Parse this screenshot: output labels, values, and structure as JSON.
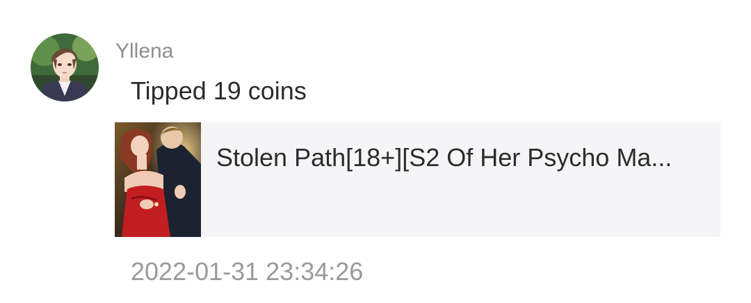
{
  "comment": {
    "username": "Yllena",
    "message": "Tipped 19 coins",
    "timestamp": "2022-01-31 23:34:26",
    "avatar_icon": "anime-man-avatar",
    "book": {
      "title": "Stolen Path[18+][S2 Of Her Psycho Ma...",
      "cover_icon": "book-cover-image"
    }
  },
  "colors": {
    "username": "#8f8f8f",
    "text": "#2b2b2b",
    "timestamp": "#9a9a9a",
    "book_card_bg": "#f5f5f7"
  }
}
